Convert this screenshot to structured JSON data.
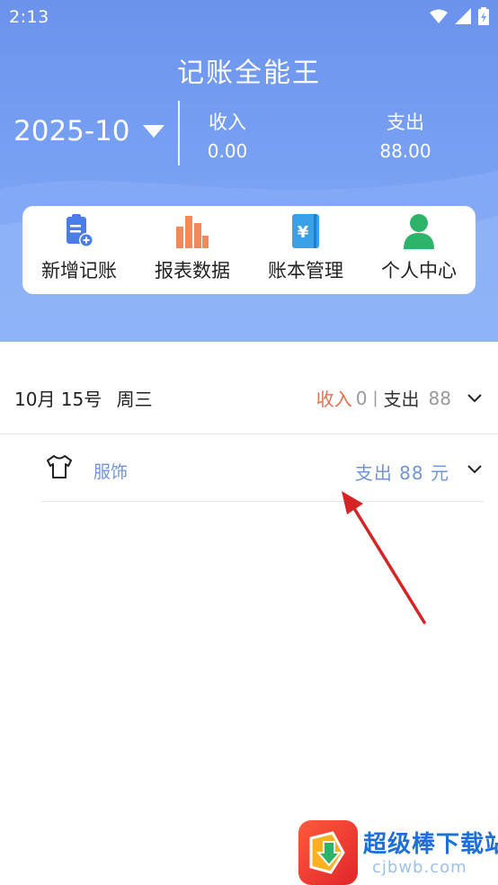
{
  "status_bar": {
    "time": "2:13"
  },
  "app": {
    "title": "记账全能王"
  },
  "summary": {
    "month": "2025-10",
    "income_label": "收入",
    "income_value": "0.00",
    "expense_label": "支出",
    "expense_value": "88.00"
  },
  "quick_actions": [
    {
      "label": "新增记账",
      "icon": "add-document-icon",
      "color": "#4a7de8"
    },
    {
      "label": "报表数据",
      "icon": "bar-chart-icon",
      "color": "#f08a5d"
    },
    {
      "label": "账本管理",
      "icon": "ledger-book-icon",
      "color": "#3aa0e8"
    },
    {
      "label": "个人中心",
      "icon": "person-icon",
      "color": "#2db36a"
    }
  ],
  "day_group": {
    "date": "10月 15号",
    "weekday": "周三",
    "income_label": "收入",
    "income_value": "0",
    "separator": "|",
    "expense_label": "支出",
    "expense_value": "88"
  },
  "entries": [
    {
      "category": "服饰",
      "icon": "tshirt-icon",
      "amount_text": "支出  88  元"
    }
  ],
  "watermark": {
    "name": "超级棒下载站",
    "url": "cjbwb.com"
  },
  "colors": {
    "header_blue": "#7aa2f3",
    "income_red": "#e07050",
    "entry_blue": "#6f95d8",
    "arrow_red": "#d62424"
  }
}
